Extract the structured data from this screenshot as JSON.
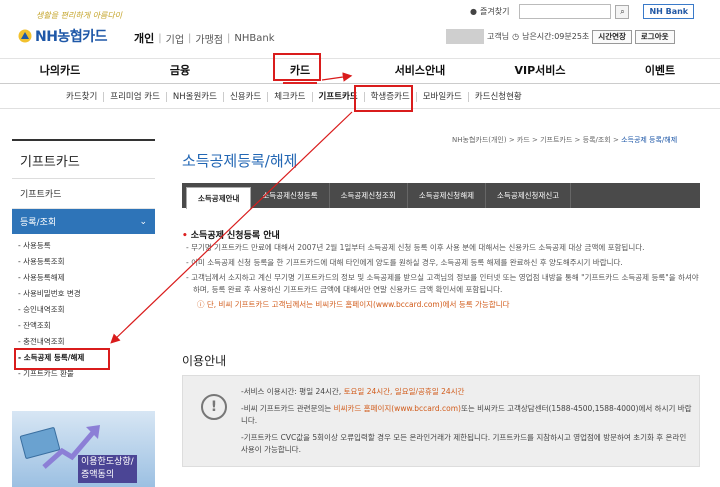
{
  "header": {
    "slogan": "생활을 편리하게 아름다이",
    "logo_text": "NH농협카드",
    "site_nav": [
      "개인",
      "기업",
      "가맹점",
      "NHBank"
    ],
    "favorites": "즐겨찾기",
    "nhbank_button": "NH Bank",
    "session_prefix": "고객님",
    "session_timer": "남은시간:09분25초",
    "extend_button": "시간연장",
    "logout_button": "로그아웃"
  },
  "gnb": [
    "나의카드",
    "금융",
    "카드",
    "서비스안내",
    "VIP서비스",
    "이벤트"
  ],
  "subgnb": [
    "카드찾기",
    "프리미엄 카드",
    "NH올원카드",
    "신용카드",
    "체크카드",
    "기프트카드",
    "학생증카드",
    "모바일카드",
    "카드신청현황"
  ],
  "lnb": {
    "title": "기프트카드",
    "item1": "기프트카드",
    "open": "등록/조회",
    "sub": [
      "사용등록",
      "사용등록조회",
      "사용등록해제",
      "사용비밀번호 변경",
      "승인내역조회",
      "잔액조회",
      "충전내역조회",
      "소득공제 등록/해제",
      "기프트카드 환불"
    ],
    "banner": [
      "이용한도상향/",
      "증액동의"
    ]
  },
  "content": {
    "breadcrumb": "NH농협카드(개인) > 카드 > 기프트카드 > 등록/조회 > ",
    "breadcrumb_current": "소득공제 등록/해제",
    "title": "소득공제등록/해제",
    "tabs": [
      "소득공제안내",
      "소득공제신청등록",
      "소득공제신청조회",
      "소득공제신청해제",
      "소득공제신청재신고"
    ],
    "section_title": "소득공제 신청등록 안내",
    "bullets": [
      "무기명 기프트카드 만료에 대해서 2007년 2월 1일부터 소득공제 신청 등록 이후 사용 분에 대해서는 신용카드 소득공제 대상 금액에 포함됩니다.",
      "이미 소득공제 신청 등록을 한 기프트카드에 대해 타인에게 양도를 원하실 경우, 소득공제 등록 해제를 완료하신 후 양도해주시기 바랍니다.",
      "고객님께서 소지하고 계신 무기명 기프트카드의 정보 및 소득공제를 받으실 고객님의 정보를 인터넷 또는 영업점 내방을 통해 \"기프트카드 소득공제 등록\"을 하셔야 하며, 등록 완료 후 사용하신 기프트카드 금액에 대해서만 연말 신용카드 금액 확인서에 포함됩니다."
    ],
    "warn": "단, 비씨 기프트카드 고객님께서는 비씨카드 홈페이지(www.bccard.com)에서 등록 가능합니다",
    "info_title": "이용안내",
    "info": {
      "line1_a": "-서비스 이용시간: 평일 24시간, ",
      "line1_b": "토요일 24시간, 일요일/공휴일 24시간",
      "line2_a": "-비씨 기프트카드 관련문의는 ",
      "line2_b": "비씨카드 홈페이지(www.bccard.com)",
      "line2_c": "또는 비씨카드 고객상담센터(1588-4500,1588-4000)에서 하시기 바랍니다.",
      "line3": "-기프트카드 CVC값을 5회이상 오류입력할 경우 모든 온라인거래가 제한됩니다. 기프트카드를 지참하시고 영업점에 방문하여 초기화 후 온라인 사용이 가능합니다."
    }
  },
  "colors": {
    "brand_blue": "#1f58a8",
    "highlight_red": "#d91c1c",
    "tab_dark": "#4a4a4a",
    "lnb_blue": "#2e74b8"
  }
}
